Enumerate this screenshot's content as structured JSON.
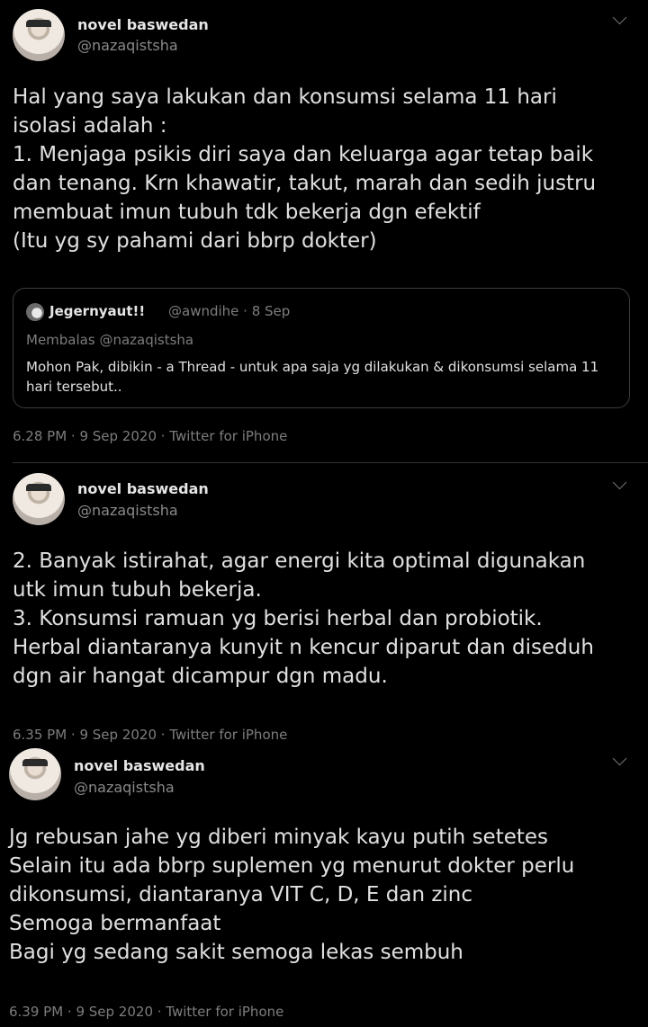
{
  "tweets": [
    {
      "author": "novel baswedan",
      "handle": "@nazaqistsha",
      "text": "Hal yang saya lakukan dan konsumsi selama 11 hari\nisolasi adalah :\n1. Menjaga psikis diri saya dan keluarga agar tetap baik\ndan tenang. Krn khawatir, takut, marah dan sedih justru\nmembuat imun tubuh tdk bekerja dgn efektif\n(Itu yg sy pahami dari bbrp dokter)",
      "timestamp": "6.28 PM · 9 Sep 2020 · Twitter for iPhone",
      "quoted": {
        "author": "Jegernyaut!!",
        "handle_date": "@awndihe · 8 Sep",
        "reply": "Membalas @nazaqistsha",
        "text": "Mohon Pak, dibikin - a Thread - untuk apa saja yg dilakukan & dikonsumsi selama 11 hari tersebut.."
      }
    },
    {
      "author": "novel baswedan",
      "handle": "@nazaqistsha",
      "text": "2. Banyak istirahat, agar energi kita optimal digunakan\nutk imun tubuh bekerja.\n3. Konsumsi ramuan yg berisi herbal dan probiotik.\nHerbal diantaranya kunyit n kencur diparut dan diseduh\ndgn air hangat dicampur dgn madu.",
      "timestamp": "6.35 PM · 9 Sep 2020 · Twitter for iPhone"
    },
    {
      "author": "novel baswedan",
      "handle": "@nazaqistsha",
      "text": "Jg rebusan jahe yg diberi minyak kayu putih setetes\nSelain itu ada bbrp suplemen yg menurut dokter perlu\ndikonsumsi, diantaranya VIT C, D, E dan zinc\nSemoga bermanfaat\nBagi yg sedang sakit semoga lekas sembuh",
      "timestamp": "6.39 PM · 9 Sep 2020 · Twitter for iPhone"
    }
  ]
}
